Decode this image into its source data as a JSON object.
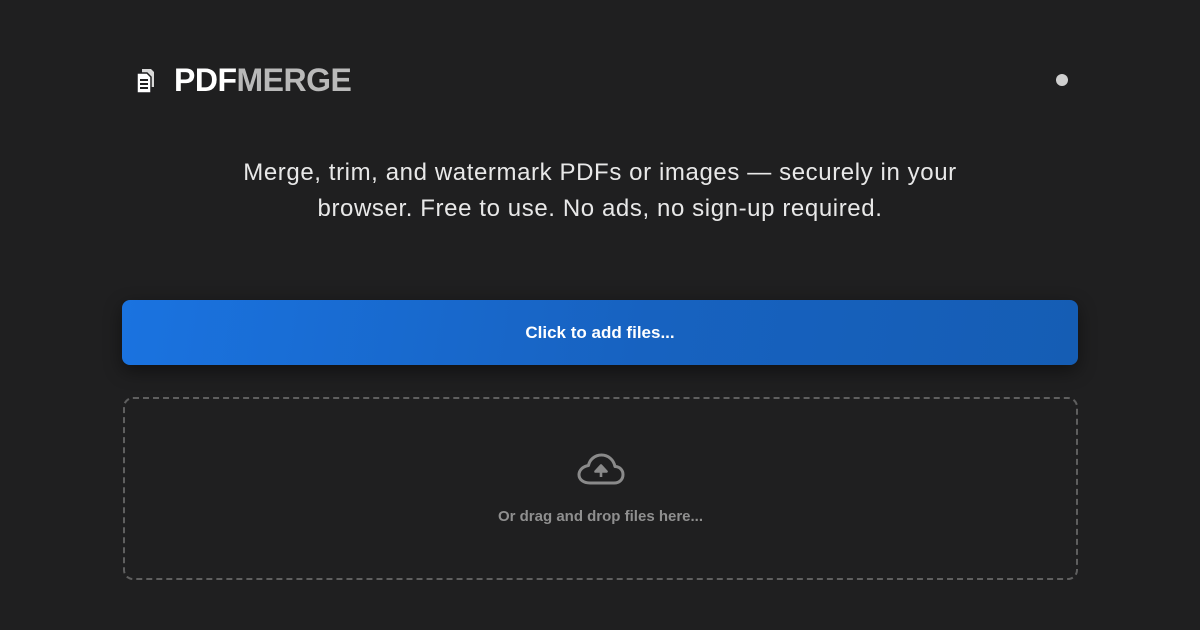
{
  "brand": {
    "name_part1": "PDF",
    "name_part2": "MERGE",
    "icon": "stacked-documents-icon"
  },
  "header": {
    "theme_toggle_icon": "theme-dot-icon"
  },
  "tagline": {
    "line1": "Merge, trim, and watermark PDFs or images — securely in your",
    "line2": "browser. Free to use. No ads, no sign-up required."
  },
  "upload": {
    "button_label": "Click to add files...",
    "drop_text": "Or drag and drop files here...",
    "drop_icon": "cloud-upload-icon"
  },
  "colors": {
    "background": "#1f1f20",
    "accent": "#1a73e0",
    "brand_secondary": "#b9b9b9",
    "muted_text": "#8f8f8f"
  }
}
